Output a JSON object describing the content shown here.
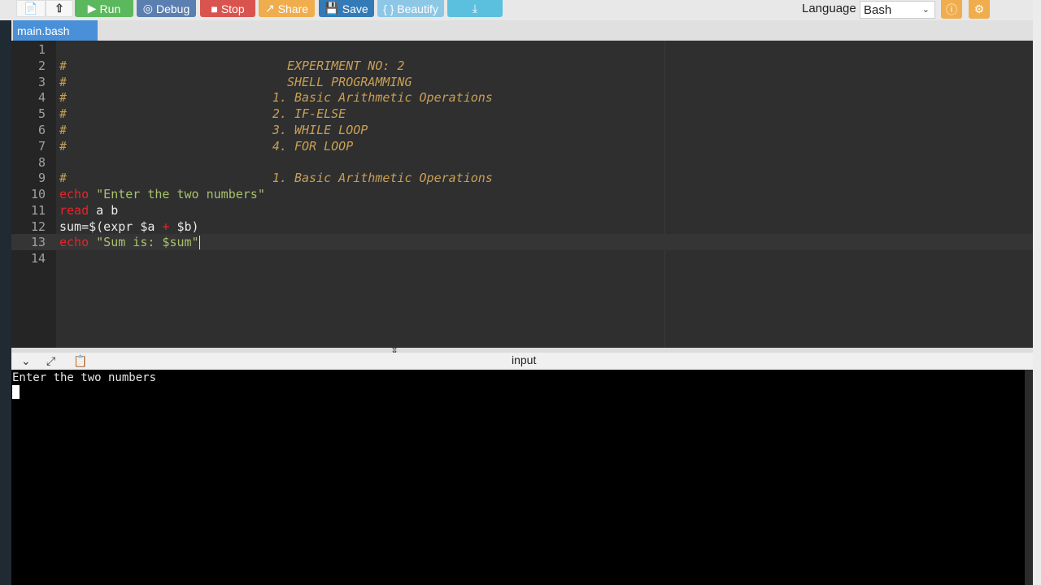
{
  "toolbar": {
    "run_label": "Run",
    "debug_label": "Debug",
    "stop_label": "Stop",
    "share_label": "Share",
    "save_label": "Save",
    "beautify_label": "{ } Beautify",
    "language_label": "Language",
    "language_value": "Bash"
  },
  "tabs": [
    {
      "label": "main.bash"
    }
  ],
  "editor": {
    "lines": [
      {
        "n": "1",
        "text": ""
      },
      {
        "n": "2",
        "text": "#                              EXPERIMENT NO: 2"
      },
      {
        "n": "3",
        "text": "#                              SHELL PROGRAMMING"
      },
      {
        "n": "4",
        "text": "#                            1. Basic Arithmetic Operations"
      },
      {
        "n": "5",
        "text": "#                            2. IF-ELSE"
      },
      {
        "n": "6",
        "text": "#                            3. WHILE LOOP"
      },
      {
        "n": "7",
        "text": "#                            4. FOR LOOP"
      },
      {
        "n": "8",
        "text": ""
      },
      {
        "n": "9",
        "text": "#                            1. Basic Arithmetic Operations"
      },
      {
        "n": "10",
        "kw": "echo",
        "rest": " \"Enter the two numbers\""
      },
      {
        "n": "11",
        "kw": "read",
        "rest": " a b"
      },
      {
        "n": "12",
        "pre": "sum=$(expr $a ",
        "op": "+",
        "post": " $b)"
      },
      {
        "n": "13",
        "kw": "echo",
        "rest": " \"Sum is: $sum\""
      },
      {
        "n": "14",
        "text": ""
      }
    ]
  },
  "output": {
    "title": "input",
    "terminal_text": "Enter the two numbers"
  },
  "colors": {
    "run": "#5cb85c",
    "debug": "#5b7fb0",
    "stop": "#d9534f",
    "share": "#f0ad4e",
    "save": "#337ab7",
    "tab": "#4a90d9"
  }
}
